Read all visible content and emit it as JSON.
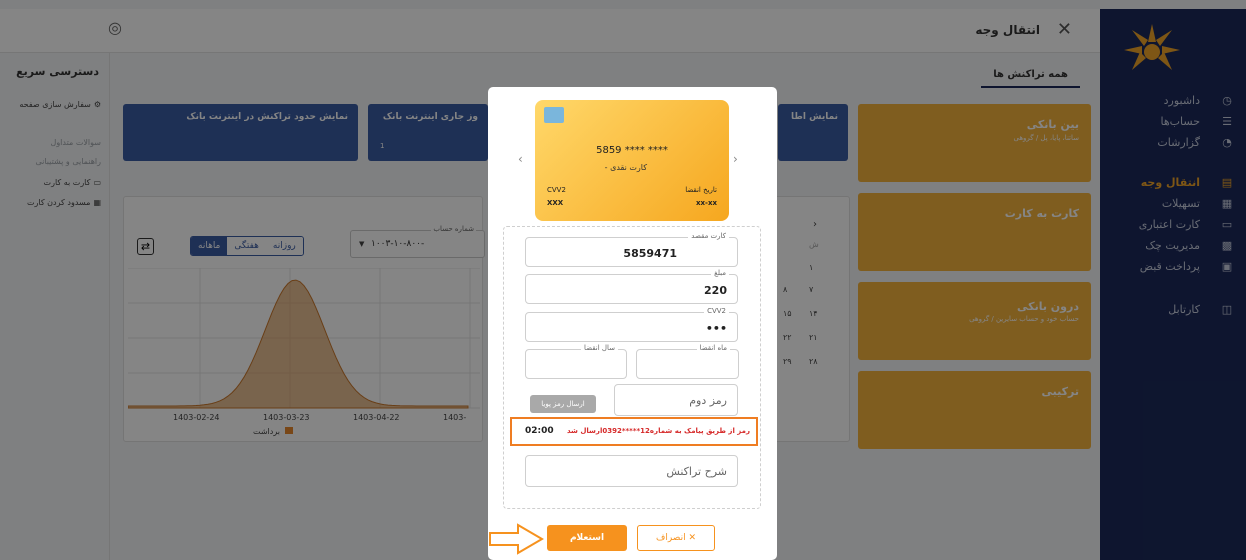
{
  "header": {
    "title": "انتقال وجه",
    "close_icon": "close-icon",
    "fingerprint_icon": "fingerprint-icon"
  },
  "sidebar": {
    "items": [
      {
        "label": "داشبورد",
        "icon": "dashboard-icon",
        "active": false
      },
      {
        "label": "حساب‌ها",
        "icon": "bank-icon",
        "active": false
      },
      {
        "label": "گزارشات",
        "icon": "report-icon",
        "active": false
      },
      {
        "label": "انتقال وجه",
        "icon": "transfer-icon",
        "active": true
      },
      {
        "label": "تسهیلات",
        "icon": "loan-icon",
        "active": false
      },
      {
        "label": "کارت اعتباری",
        "icon": "credit-card-icon",
        "active": false
      },
      {
        "label": "مدیریت چک",
        "icon": "cheque-icon",
        "active": false
      },
      {
        "label": "پرداخت قبض",
        "icon": "bill-icon",
        "active": false
      },
      {
        "label": "کارتابل",
        "icon": "briefcase-icon",
        "active": false
      }
    ]
  },
  "quick": {
    "title": "دسترسی سریع",
    "customize": "سفارش سازی صفحه",
    "faq": "سوالات متداول",
    "support": "راهنمایی و پشتیبانی",
    "card_to_card": "کارت به کارت",
    "block_card": "مسدود کردن کارت"
  },
  "tabs": {
    "all_transactions": "همه تراکنش ها"
  },
  "top_cards": [
    {
      "label": "نمایش حدود تراکنش در اینترنت بانک"
    },
    {
      "label": "وز جاری اینترنت بانک",
      "count": "1"
    },
    {
      "label": "نمایش اطا"
    }
  ],
  "transfer_types": [
    {
      "title": "بین بانکی",
      "subtitle": "ساتنا، پایا، پل / گروهی"
    },
    {
      "title": "کارت به کارت",
      "subtitle": ""
    },
    {
      "title": "درون بانکی",
      "subtitle": "حساب خود و حساب سایرین / گروهی"
    },
    {
      "title": "ترکیبی",
      "subtitle": ""
    }
  ],
  "chart_panel": {
    "periods": [
      "روزانه",
      "هفتگی",
      "ماهانه"
    ],
    "selected_period": "ماهانه",
    "account_label": "شماره حساب",
    "account_value": "۱۰۰۳-۱۰-۸۰۰-",
    "legend": "برداشت"
  },
  "chart_data": {
    "type": "area",
    "x": [
      "1403-02-24",
      "1403-03-23",
      "1403-04-22",
      "1403-"
    ],
    "series": [
      {
        "name": "برداشت",
        "values": [
          0.05,
          0.95,
          0.35,
          0.02
        ]
      }
    ],
    "legend_placement": "bottom",
    "grid": true
  },
  "calendar": {
    "header": "ش",
    "rows": [
      [
        "۱"
      ],
      [
        "۷",
        "۸"
      ],
      [
        "۱۴",
        "۱۵"
      ],
      [
        "۲۱",
        "۲۲"
      ],
      [
        "۲۸",
        "۲۹"
      ]
    ]
  },
  "modal": {
    "card": {
      "number": "5859 **** ****",
      "type": "- کارت نقدی",
      "cvv_label": "CVV2",
      "cvv_value": "XXX",
      "expiry_label": "تاریخ انقضا",
      "expiry_value": "xx-xx"
    },
    "dest_card": {
      "label": "کارت مقصد",
      "value": "5859471"
    },
    "amount": {
      "label": "مبلغ",
      "value": "220"
    },
    "cvv2": {
      "label": "CVV2",
      "value": "•••"
    },
    "exp_month": {
      "label": "ماه انقضا",
      "value": ""
    },
    "exp_year": {
      "label": "سال انقضا",
      "value": ""
    },
    "second_pin": {
      "placeholder": "رمز دوم"
    },
    "otp_button": "ارسال رمز پویا",
    "otp_message": "رمز از طریق پیامک به شماره12*****0392ارسال شد",
    "otp_timer": "02:00",
    "description": {
      "placeholder": "شرح تراکنش"
    },
    "confirm": "استعلام",
    "cancel": "انصراف"
  },
  "colors": {
    "navy": "#1b2a5a",
    "accent": "#f6921e",
    "card_blue": "#3b5ca3",
    "alert": "#d62a2a"
  }
}
